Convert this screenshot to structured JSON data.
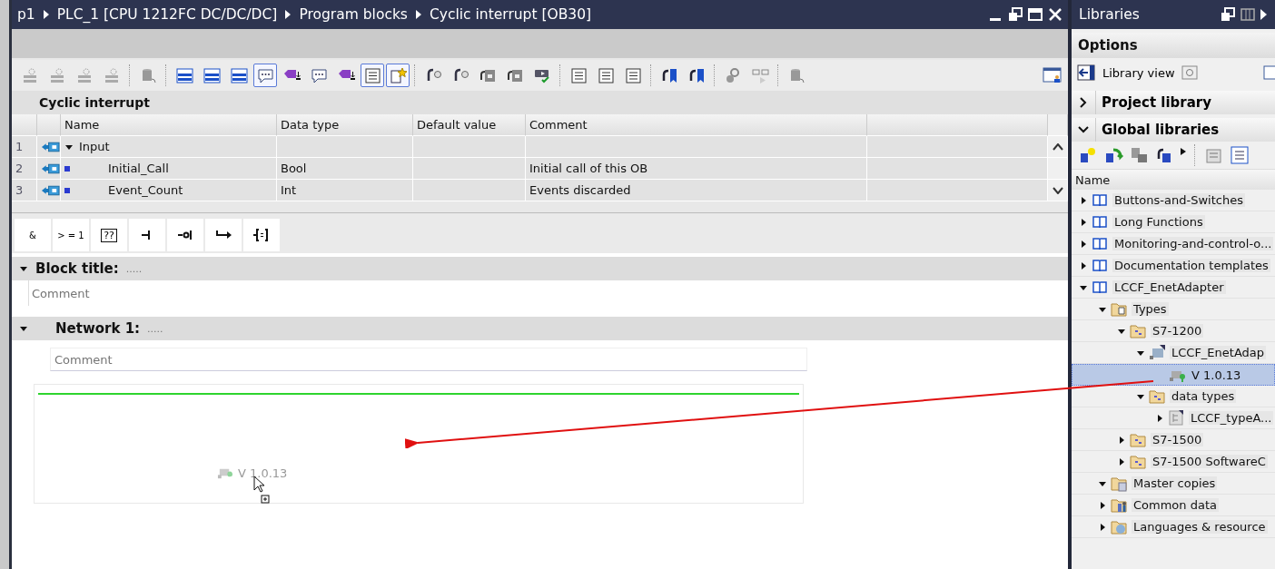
{
  "editor": {
    "breadcrumb": [
      "p1",
      "PLC_1 [CPU 1212FC DC/DC/DC]",
      "Program blocks",
      "Cyclic interrupt [OB30]"
    ],
    "toolbar": [
      {
        "kind": "gear",
        "on": false
      },
      {
        "kind": "gear",
        "on": false
      },
      {
        "kind": "gear",
        "on": false
      },
      {
        "kind": "gear",
        "on": false
      },
      {
        "kind": "sep"
      },
      {
        "kind": "cylinder",
        "on": false
      },
      {
        "kind": "sep"
      },
      {
        "kind": "rows",
        "on": false
      },
      {
        "kind": "rows",
        "on": false
      },
      {
        "kind": "rows",
        "on": false
      },
      {
        "kind": "bubble",
        "on": true
      },
      {
        "kind": "tag",
        "on": false
      },
      {
        "kind": "bubble",
        "on": false
      },
      {
        "kind": "tag",
        "on": false
      },
      {
        "kind": "list",
        "on": true
      },
      {
        "kind": "star",
        "on": true
      },
      {
        "kind": "sep"
      },
      {
        "kind": "circle-arrow",
        "on": false
      },
      {
        "kind": "circle-arrow",
        "on": false
      },
      {
        "kind": "chip",
        "on": false
      },
      {
        "kind": "chip",
        "on": false
      },
      {
        "kind": "check",
        "on": false
      },
      {
        "kind": "sep"
      },
      {
        "kind": "list",
        "on": false
      },
      {
        "kind": "list",
        "on": false
      },
      {
        "kind": "list",
        "on": false
      },
      {
        "kind": "sep"
      },
      {
        "kind": "bookmark",
        "on": false
      },
      {
        "kind": "bookmark",
        "on": false
      },
      {
        "kind": "sep"
      },
      {
        "kind": "magnifier",
        "on": false
      },
      {
        "kind": "glasses",
        "on": false
      },
      {
        "kind": "sep"
      },
      {
        "kind": "cylinder",
        "on": false
      }
    ],
    "interface_title": "Cyclic interrupt",
    "table": {
      "columns": [
        "Name",
        "Data type",
        "Default value",
        "Comment"
      ],
      "rows": [
        {
          "number": "1",
          "name": "Input",
          "kind": "section",
          "expanded": true,
          "data_type": "",
          "comment": ""
        },
        {
          "number": "2",
          "name": "Initial_Call",
          "kind": "parameter",
          "data_type": "Bool",
          "comment": "Initial call of this OB"
        },
        {
          "number": "3",
          "name": "Event_Count",
          "kind": "parameter",
          "data_type": "Int",
          "comment": "Events discarded"
        }
      ]
    },
    "instructions": [
      {
        "kind": "text",
        "label": "&"
      },
      {
        "kind": "text",
        "label": "> = 1"
      },
      {
        "kind": "box",
        "label": "??"
      },
      {
        "kind": "contact"
      },
      {
        "kind": "negated-contact"
      },
      {
        "kind": "branch"
      },
      {
        "kind": "coil"
      }
    ],
    "block_title": {
      "label": "Block title:",
      "value": ".....",
      "expanded": true,
      "comment_placeholder": "Comment"
    },
    "network": {
      "label": "Network 1:",
      "value": ".....",
      "expanded": true,
      "comment_placeholder": "Comment"
    },
    "drag_item": {
      "label": "V 1.0.13"
    }
  },
  "libraries": {
    "title": "Libraries",
    "options": "Options",
    "library_view": "Library view",
    "sections": [
      {
        "label": "Project library",
        "expanded": false
      },
      {
        "label": "Global libraries",
        "expanded": true
      }
    ],
    "column": "Name",
    "tree": [
      {
        "label": "Buttons-and-Switches",
        "kind": "library",
        "expanded": false,
        "selected": false
      },
      {
        "label": "Long Functions",
        "kind": "library",
        "expanded": false,
        "selected": false
      },
      {
        "label": "Monitoring-and-control-o...",
        "kind": "library",
        "expanded": false,
        "selected": false
      },
      {
        "label": "Documentation templates",
        "kind": "library",
        "expanded": false,
        "selected": false
      },
      {
        "label": "LCCF_EnetAdapter",
        "kind": "library",
        "expanded": true,
        "selected": false,
        "children": [
          {
            "label": "Types",
            "kind": "types",
            "expanded": true,
            "selected": false,
            "children": [
              {
                "label": "S7-1200",
                "kind": "group",
                "expanded": true,
                "selected": false,
                "children": [
                  {
                    "label": "LCCF_EnetAdap",
                    "kind": "type",
                    "expanded": true,
                    "selected": false,
                    "children": [
                      {
                        "label": "V 1.0.13",
                        "kind": "version",
                        "selected": true
                      }
                    ]
                  },
                  {
                    "label": "data types",
                    "kind": "group",
                    "expanded": true,
                    "selected": false,
                    "children": [
                      {
                        "label": "LCCF_typeA...",
                        "kind": "datatype",
                        "expanded": false,
                        "selected": false
                      }
                    ]
                  }
                ]
              },
              {
                "label": "S7-1500",
                "kind": "group",
                "expanded": false,
                "selected": false
              },
              {
                "label": "S7-1500 SoftwareC",
                "kind": "group",
                "expanded": false,
                "selected": false
              }
            ]
          },
          {
            "label": "Master copies",
            "kind": "masters",
            "expanded": true,
            "selected": false
          },
          {
            "label": "Common data",
            "kind": "common",
            "expanded": false,
            "selected": false
          },
          {
            "label": "Languages & resource",
            "kind": "languages",
            "expanded": false,
            "selected": false
          }
        ]
      }
    ]
  }
}
